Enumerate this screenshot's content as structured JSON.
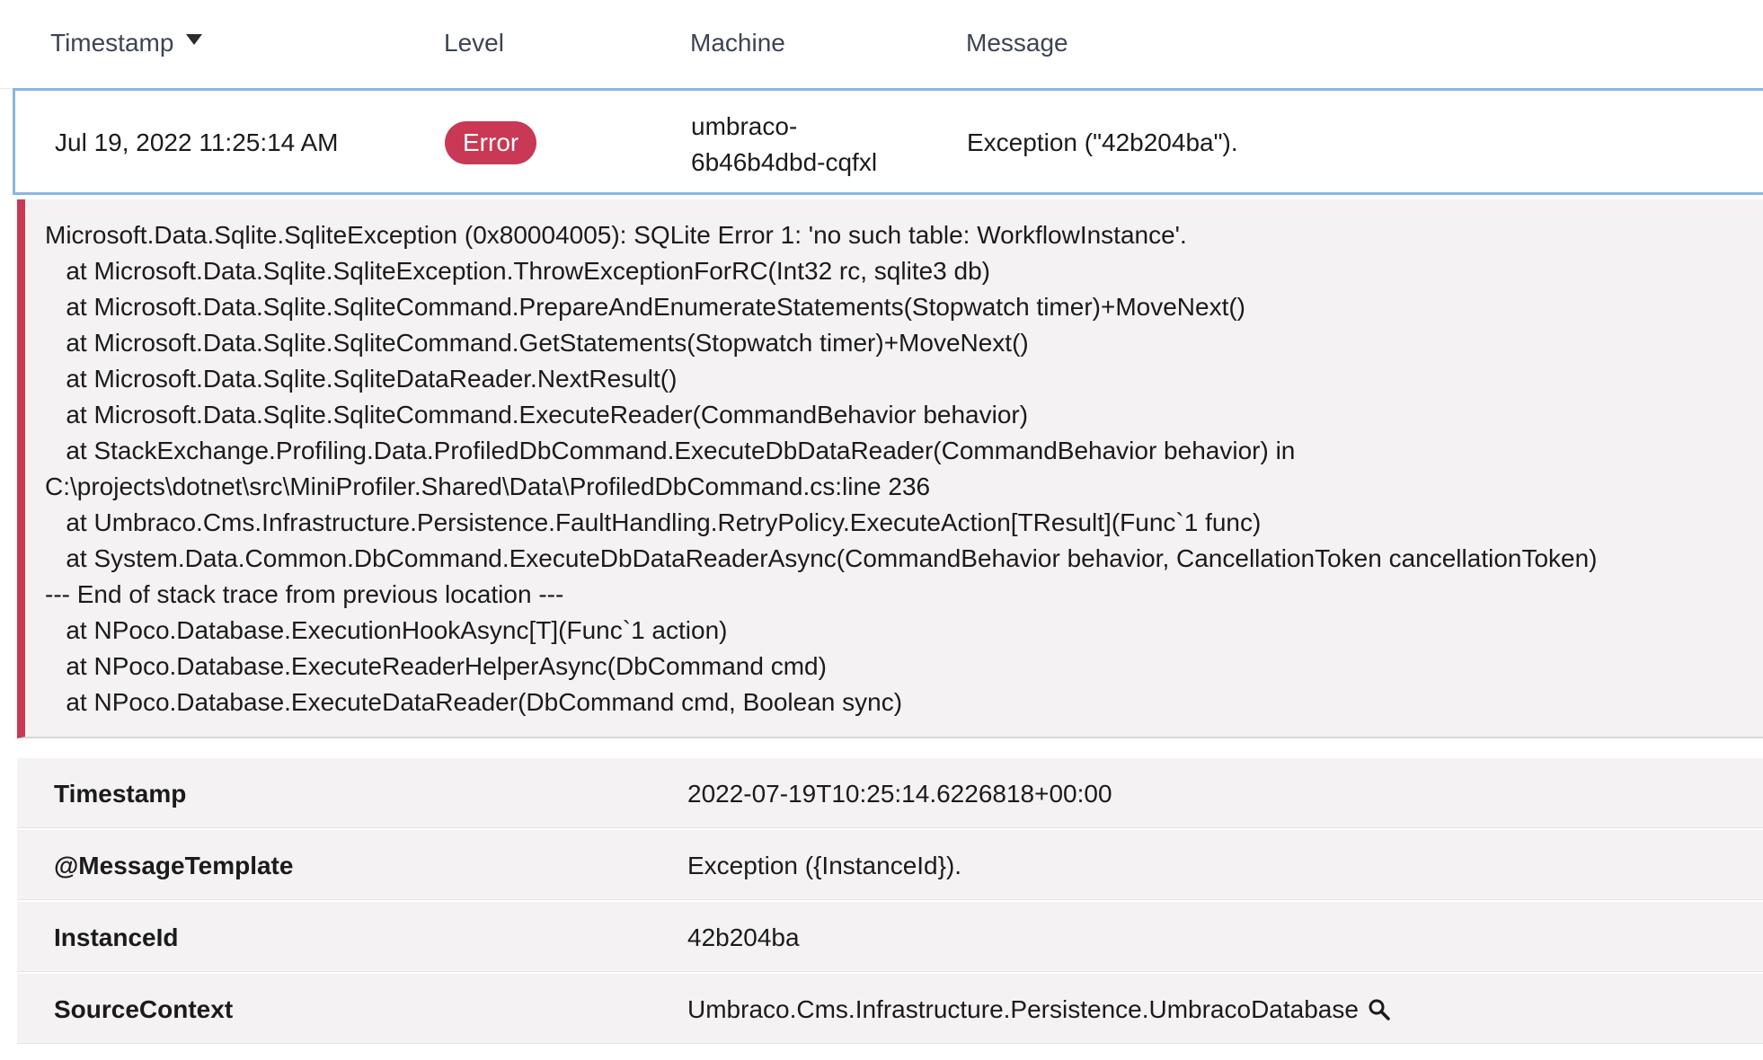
{
  "table_header": {
    "timestamp": "Timestamp",
    "level": "Level",
    "machine": "Machine",
    "message": "Message"
  },
  "log_entry": {
    "timestamp": "Jul 19, 2022 11:25:14 AM",
    "level": "Error",
    "machine_line1": "umbraco-",
    "machine_line2": "6b46b4dbd-cqfxl",
    "message": "Exception (\"42b204ba\")."
  },
  "exception": {
    "lines": [
      "Microsoft.Data.Sqlite.SqliteException (0x80004005): SQLite Error 1: 'no such table: WorkflowInstance'.",
      "   at Microsoft.Data.Sqlite.SqliteException.ThrowExceptionForRC(Int32 rc, sqlite3 db)",
      "   at Microsoft.Data.Sqlite.SqliteCommand.PrepareAndEnumerateStatements(Stopwatch timer)+MoveNext()",
      "   at Microsoft.Data.Sqlite.SqliteCommand.GetStatements(Stopwatch timer)+MoveNext()",
      "   at Microsoft.Data.Sqlite.SqliteDataReader.NextResult()",
      "   at Microsoft.Data.Sqlite.SqliteCommand.ExecuteReader(CommandBehavior behavior)",
      "   at StackExchange.Profiling.Data.ProfiledDbCommand.ExecuteDbDataReader(CommandBehavior behavior) in",
      "C:\\projects\\dotnet\\src\\MiniProfiler.Shared\\Data\\ProfiledDbCommand.cs:line 236",
      "   at Umbraco.Cms.Infrastructure.Persistence.FaultHandling.RetryPolicy.ExecuteAction[TResult](Func`1 func)",
      "   at System.Data.Common.DbCommand.ExecuteDbDataReaderAsync(CommandBehavior behavior, CancellationToken cancellationToken)",
      "--- End of stack trace from previous location ---",
      "   at NPoco.Database.ExecutionHookAsync[T](Func`1 action)",
      "   at NPoco.Database.ExecuteReaderHelperAsync(DbCommand cmd)",
      "   at NPoco.Database.ExecuteDataReader(DbCommand cmd, Boolean sync)"
    ]
  },
  "properties": [
    {
      "name": "Timestamp",
      "value": "2022-07-19T10:25:14.6226818+00:00"
    },
    {
      "name": "@MessageTemplate",
      "value": "Exception ({InstanceId})."
    },
    {
      "name": "InstanceId",
      "value": "42b204ba"
    },
    {
      "name": "SourceContext",
      "value": "Umbraco.Cms.Infrastructure.Persistence.UmbracoDatabase",
      "icon": "search-icon"
    }
  ],
  "colors": {
    "error_badge": "#c93855",
    "selected_border": "#8bb6e4",
    "exception_bg": "#f4f2f3"
  }
}
